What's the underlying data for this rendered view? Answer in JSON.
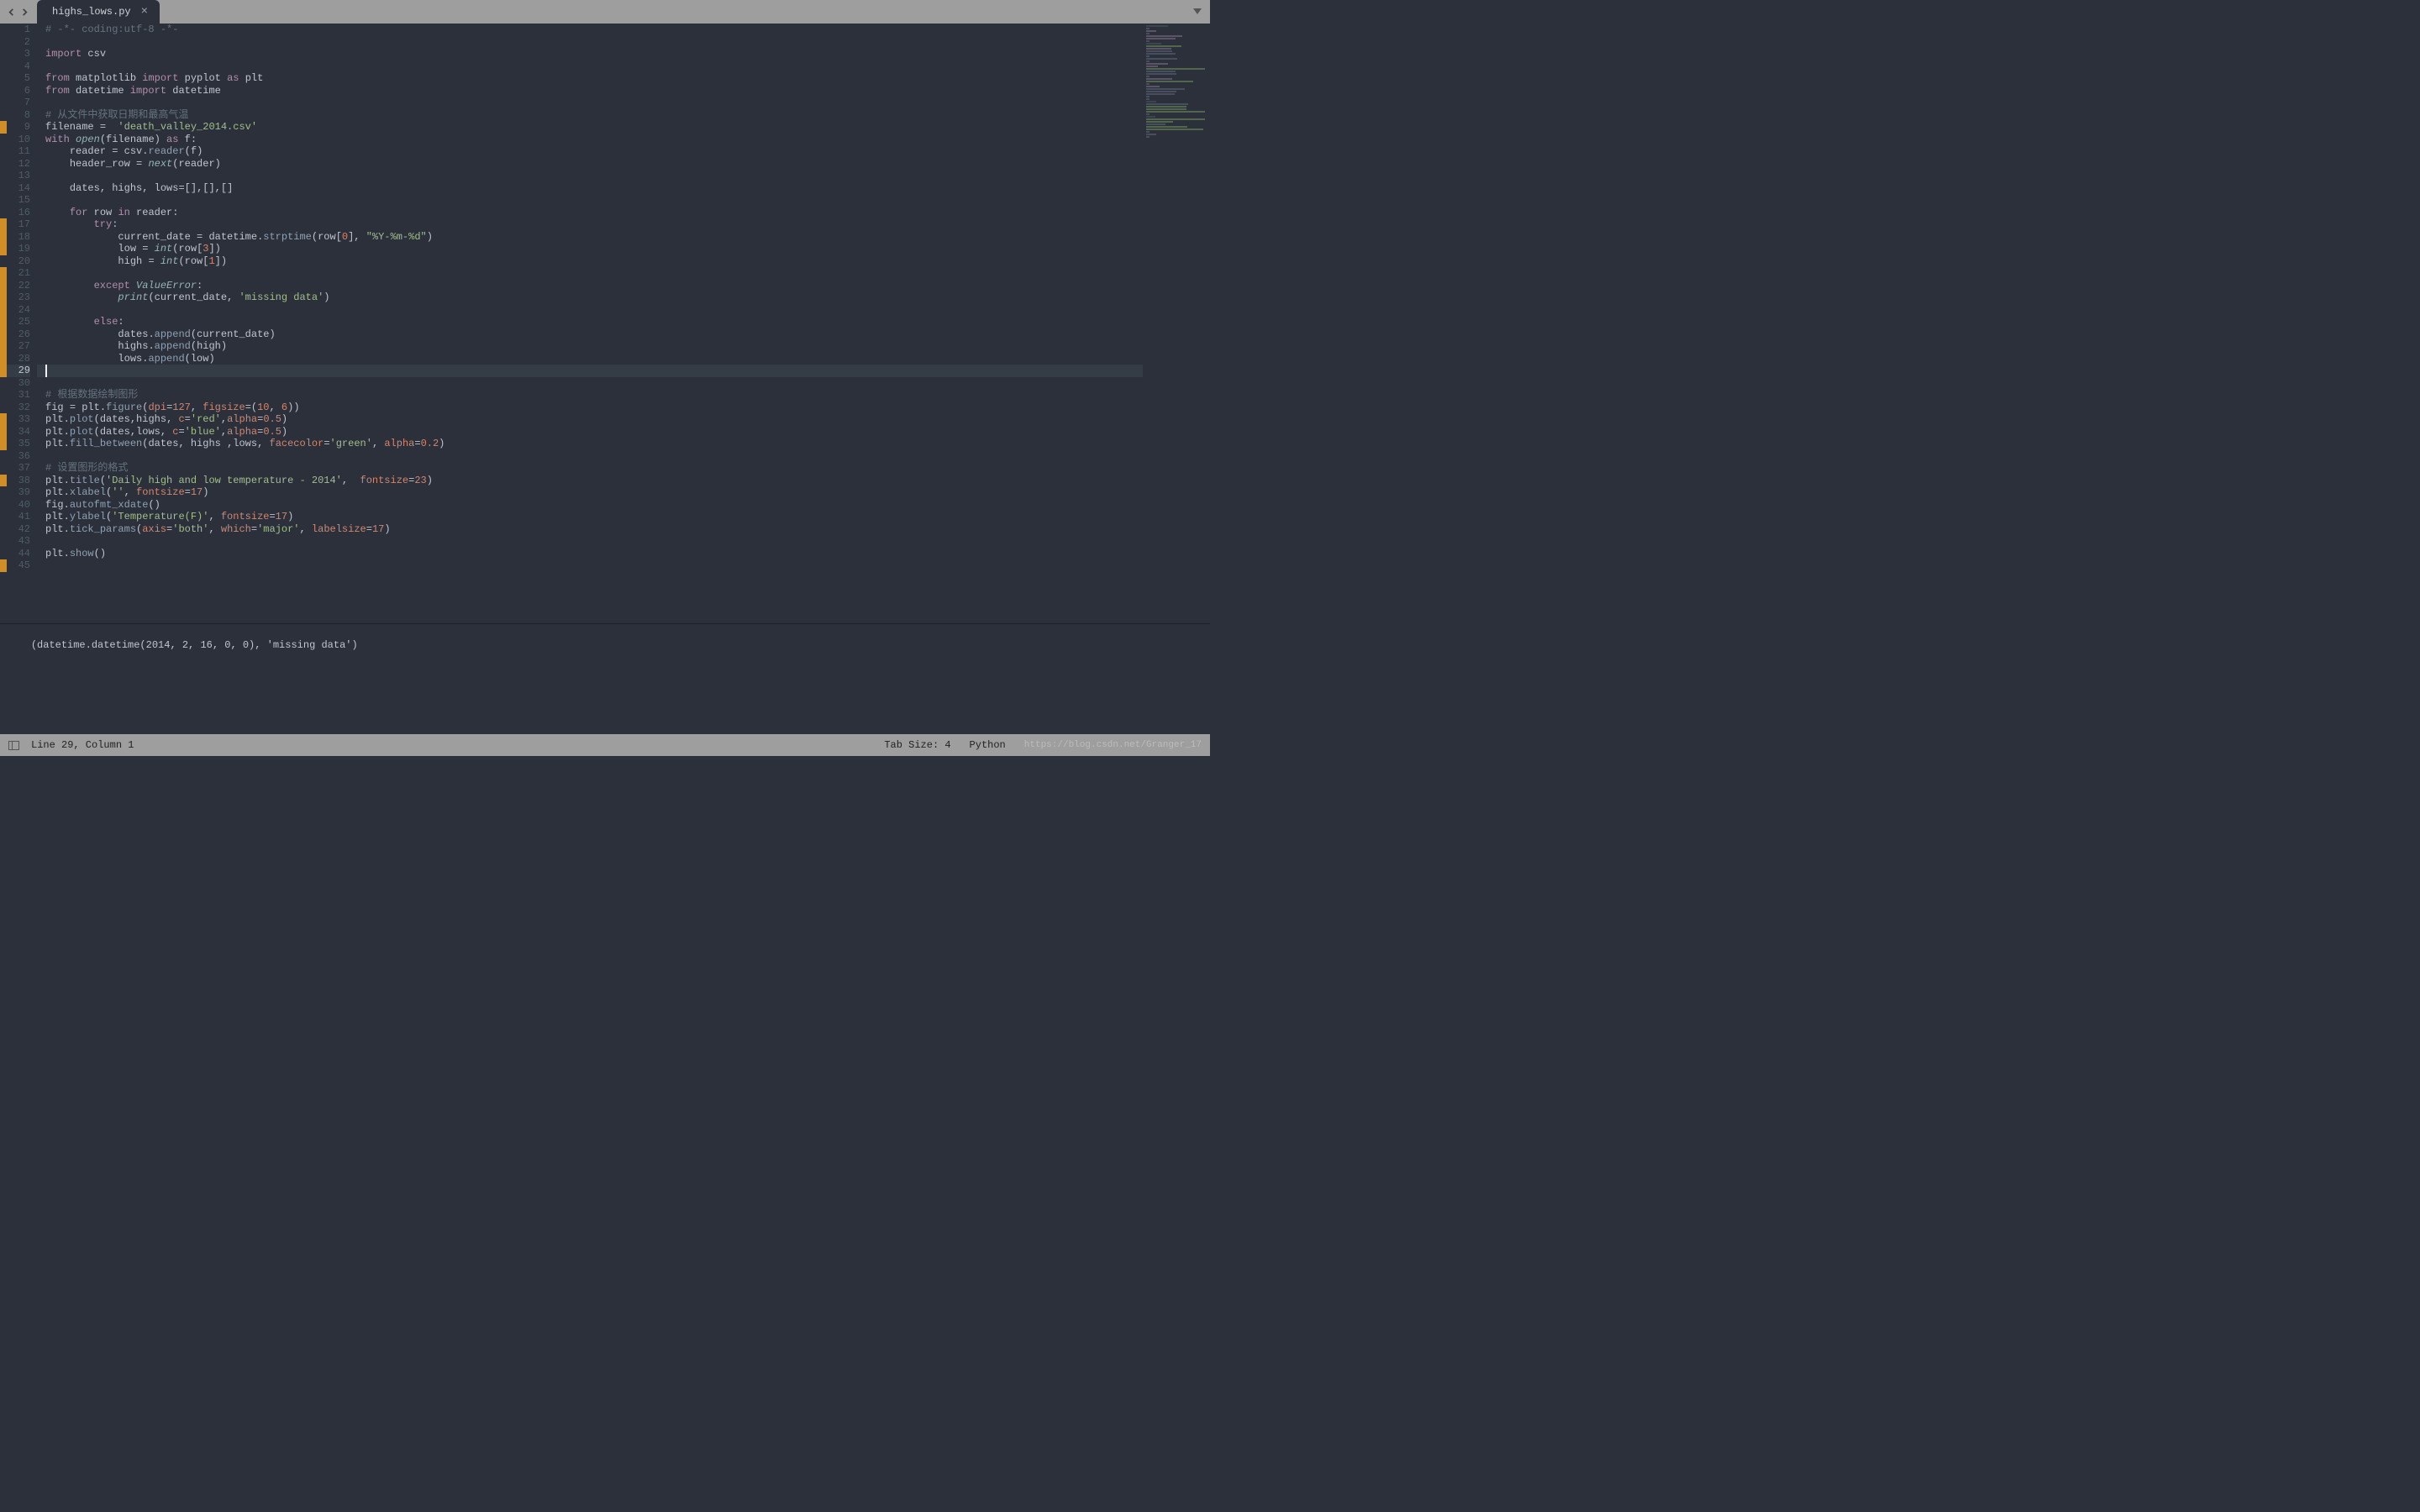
{
  "tab": {
    "filename": "highs_lows.py"
  },
  "lines": [
    {
      "n": 1,
      "m": false,
      "html": "<span class='cm'># -*- coding:utf-8 -*-</span>"
    },
    {
      "n": 2,
      "m": false,
      "html": ""
    },
    {
      "n": 3,
      "m": false,
      "html": "<span class='kw'>import</span> <span class='va'>csv</span>"
    },
    {
      "n": 4,
      "m": false,
      "html": ""
    },
    {
      "n": 5,
      "m": false,
      "html": "<span class='kw'>from</span> <span class='va'>matplotlib</span> <span class='kw'>import</span> <span class='va'>pyplot</span> <span class='kw'>as</span> <span class='va'>plt</span>"
    },
    {
      "n": 6,
      "m": false,
      "html": "<span class='kw'>from</span> <span class='va'>datetime</span> <span class='kw'>import</span> <span class='va'>datetime</span>"
    },
    {
      "n": 7,
      "m": false,
      "html": ""
    },
    {
      "n": 8,
      "m": false,
      "html": "<span class='cm'># 从文件中获取日期和最高气温</span>"
    },
    {
      "n": 9,
      "m": true,
      "html": "<span class='va'>filename</span> <span class='op'>=</span>  <span class='st'>'death_valley_2014.csv'</span>"
    },
    {
      "n": 10,
      "m": false,
      "html": "<span class='kw'>with</span> <span class='bi'>open</span><span class='op'>(</span><span class='va'>filename</span><span class='op'>)</span> <span class='kw'>as</span> <span class='va'>f</span><span class='op'>:</span>"
    },
    {
      "n": 11,
      "m": false,
      "html": "    <span class='va'>reader</span> <span class='op'>=</span> <span class='va'>csv</span><span class='op'>.</span><span class='fn'>reader</span><span class='op'>(</span><span class='va'>f</span><span class='op'>)</span>"
    },
    {
      "n": 12,
      "m": false,
      "html": "    <span class='va'>header_row</span> <span class='op'>=</span> <span class='bi'>next</span><span class='op'>(</span><span class='va'>reader</span><span class='op'>)</span>"
    },
    {
      "n": 13,
      "m": false,
      "html": ""
    },
    {
      "n": 14,
      "m": false,
      "html": "    <span class='va'>dates</span><span class='op'>,</span> <span class='va'>highs</span><span class='op'>,</span> <span class='va'>lows</span><span class='op'>=[],[],[]</span>"
    },
    {
      "n": 15,
      "m": false,
      "html": ""
    },
    {
      "n": 16,
      "m": false,
      "html": "    <span class='kw'>for</span> <span class='va'>row</span> <span class='kw'>in</span> <span class='va'>reader</span><span class='op'>:</span>"
    },
    {
      "n": 17,
      "m": true,
      "html": "        <span class='kw'>try</span><span class='op'>:</span>"
    },
    {
      "n": 18,
      "m": true,
      "html": "            <span class='va'>current_date</span> <span class='op'>=</span> <span class='va'>datetime</span><span class='op'>.</span><span class='fn'>strptime</span><span class='op'>(</span><span class='va'>row</span><span class='op'>[</span><span class='nm'>0</span><span class='op'>],</span> <span class='st'>\"%Y-%m-%d\"</span><span class='op'>)</span>"
    },
    {
      "n": 19,
      "m": true,
      "html": "            <span class='va'>low</span> <span class='op'>=</span> <span class='bi'>int</span><span class='op'>(</span><span class='va'>row</span><span class='op'>[</span><span class='nm'>3</span><span class='op'>])</span>"
    },
    {
      "n": 20,
      "m": false,
      "html": "            <span class='va'>high</span> <span class='op'>=</span> <span class='bi'>int</span><span class='op'>(</span><span class='va'>row</span><span class='op'>[</span><span class='nm'>1</span><span class='op'>])</span>"
    },
    {
      "n": 21,
      "m": true,
      "html": ""
    },
    {
      "n": 22,
      "m": true,
      "html": "        <span class='kw'>except</span> <span class='bi'>ValueError</span><span class='op'>:</span>"
    },
    {
      "n": 23,
      "m": true,
      "html": "            <span class='bi'>print</span><span class='op'>(</span><span class='va'>current_date</span><span class='op'>,</span> <span class='st'>'missing data'</span><span class='op'>)</span>"
    },
    {
      "n": 24,
      "m": true,
      "html": ""
    },
    {
      "n": 25,
      "m": true,
      "html": "        <span class='kw'>else</span><span class='op'>:</span>"
    },
    {
      "n": 26,
      "m": true,
      "html": "            <span class='va'>dates</span><span class='op'>.</span><span class='fn'>append</span><span class='op'>(</span><span class='va'>current_date</span><span class='op'>)</span>"
    },
    {
      "n": 27,
      "m": true,
      "html": "            <span class='va'>highs</span><span class='op'>.</span><span class='fn'>append</span><span class='op'>(</span><span class='va'>high</span><span class='op'>)</span>"
    },
    {
      "n": 28,
      "m": true,
      "html": "            <span class='va'>lows</span><span class='op'>.</span><span class='fn'>append</span><span class='op'>(</span><span class='va'>low</span><span class='op'>)</span>"
    },
    {
      "n": 29,
      "m": true,
      "html": "",
      "current": true
    },
    {
      "n": 30,
      "m": false,
      "html": ""
    },
    {
      "n": 31,
      "m": false,
      "html": "<span class='cm'># 根据数据绘制图形</span>"
    },
    {
      "n": 32,
      "m": false,
      "html": "<span class='va'>fig</span> <span class='op'>=</span> <span class='va'>plt</span><span class='op'>.</span><span class='fn'>figure</span><span class='op'>(</span><span class='kw2'>dpi</span><span class='op'>=</span><span class='nm'>127</span><span class='op'>,</span> <span class='kw2'>figsize</span><span class='op'>=(</span><span class='nm'>10</span><span class='op'>,</span> <span class='nm'>6</span><span class='op'>))</span>"
    },
    {
      "n": 33,
      "m": true,
      "html": "<span class='va'>plt</span><span class='op'>.</span><span class='fn'>plot</span><span class='op'>(</span><span class='va'>dates</span><span class='op'>,</span><span class='va'>highs</span><span class='op'>,</span> <span class='kw2'>c</span><span class='op'>=</span><span class='st'>'red'</span><span class='op'>,</span><span class='kw2'>alpha</span><span class='op'>=</span><span class='nm'>0.5</span><span class='op'>)</span>"
    },
    {
      "n": 34,
      "m": true,
      "html": "<span class='va'>plt</span><span class='op'>.</span><span class='fn'>plot</span><span class='op'>(</span><span class='va'>dates</span><span class='op'>,</span><span class='va'>lows</span><span class='op'>,</span> <span class='kw2'>c</span><span class='op'>=</span><span class='st'>'blue'</span><span class='op'>,</span><span class='kw2'>alpha</span><span class='op'>=</span><span class='nm'>0.5</span><span class='op'>)</span>"
    },
    {
      "n": 35,
      "m": true,
      "html": "<span class='va'>plt</span><span class='op'>.</span><span class='fn'>fill_between</span><span class='op'>(</span><span class='va'>dates</span><span class='op'>,</span> <span class='va'>highs</span> <span class='op'>,</span><span class='va'>lows</span><span class='op'>,</span> <span class='kw2'>facecolor</span><span class='op'>=</span><span class='st'>'green'</span><span class='op'>,</span> <span class='kw2'>alpha</span><span class='op'>=</span><span class='nm'>0.2</span><span class='op'>)</span>"
    },
    {
      "n": 36,
      "m": false,
      "html": ""
    },
    {
      "n": 37,
      "m": false,
      "html": "<span class='cm'># 设置图形的格式</span>"
    },
    {
      "n": 38,
      "m": true,
      "html": "<span class='va'>plt</span><span class='op'>.</span><span class='fn'>title</span><span class='op'>(</span><span class='st'>'Daily high and low temperature - 2014'</span><span class='op'>,</span>  <span class='kw2'>fontsize</span><span class='op'>=</span><span class='nm'>23</span><span class='op'>)</span>"
    },
    {
      "n": 39,
      "m": false,
      "html": "<span class='va'>plt</span><span class='op'>.</span><span class='fn'>xlabel</span><span class='op'>(</span><span class='st'>''</span><span class='op'>,</span> <span class='kw2'>fontsize</span><span class='op'>=</span><span class='nm'>17</span><span class='op'>)</span>"
    },
    {
      "n": 40,
      "m": false,
      "html": "<span class='va'>fig</span><span class='op'>.</span><span class='fn'>autofmt_xdate</span><span class='op'>()</span>"
    },
    {
      "n": 41,
      "m": false,
      "html": "<span class='va'>plt</span><span class='op'>.</span><span class='fn'>ylabel</span><span class='op'>(</span><span class='st'>'Temperature(F)'</span><span class='op'>,</span> <span class='kw2'>fontsize</span><span class='op'>=</span><span class='nm'>17</span><span class='op'>)</span>"
    },
    {
      "n": 42,
      "m": false,
      "html": "<span class='va'>plt</span><span class='op'>.</span><span class='fn'>tick_params</span><span class='op'>(</span><span class='kw2'>axis</span><span class='op'>=</span><span class='st'>'both'</span><span class='op'>,</span> <span class='kw2'>which</span><span class='op'>=</span><span class='st'>'major'</span><span class='op'>,</span> <span class='kw2'>labelsize</span><span class='op'>=</span><span class='nm'>17</span><span class='op'>)</span>"
    },
    {
      "n": 43,
      "m": false,
      "html": ""
    },
    {
      "n": 44,
      "m": false,
      "html": "<span class='va'>plt</span><span class='op'>.</span><span class='fn'>show</span><span class='op'>()</span>"
    },
    {
      "n": 45,
      "m": true,
      "html": ""
    }
  ],
  "console": "(datetime.datetime(2014, 2, 16, 0, 0), 'missing data')",
  "status": {
    "cursor": "Line 29, Column 1",
    "tab_size": "Tab Size: 4",
    "language": "Python"
  },
  "watermark": "https://blog.csdn.net/Granger_17"
}
